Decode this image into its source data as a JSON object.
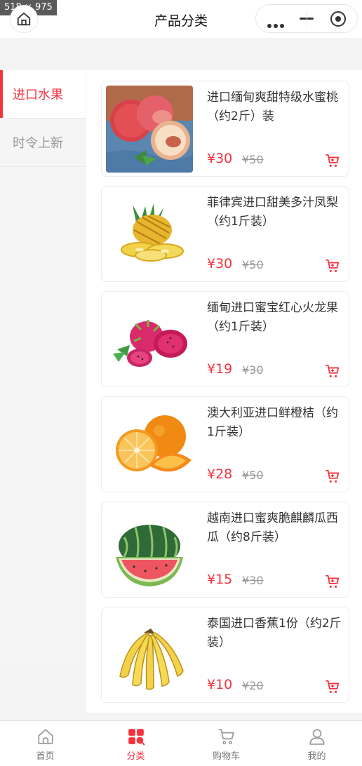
{
  "overlay": {
    "dimensions": "518 × 975"
  },
  "navbar": {
    "title": "产品分类"
  },
  "sidebar": {
    "items": [
      {
        "label": "进口水果"
      },
      {
        "label": "时令上新"
      }
    ]
  },
  "products": [
    {
      "name": "进口缅甸爽甜特级水蜜桃（约2斤）装",
      "price": "¥30",
      "old_price": "¥50",
      "image": "peach-image"
    },
    {
      "name": "菲律宾进口甜美多汁凤梨（约1斤装）",
      "price": "¥30",
      "old_price": "¥50",
      "image": "pineapple-image"
    },
    {
      "name": "缅甸进口蜜宝红心火龙果（约1斤装）",
      "price": "¥19",
      "old_price": "¥30",
      "image": "dragon-fruit-image"
    },
    {
      "name": "澳大利亚进口鲜橙桔（约1斤装）",
      "price": "¥28",
      "old_price": "¥50",
      "image": "orange-image"
    },
    {
      "name": "越南进口蜜爽脆麒麟瓜西瓜（约8斤装）",
      "price": "¥15",
      "old_price": "¥30",
      "image": "watermelon-image"
    },
    {
      "name": "泰国进口香蕉1份（约2斤装）",
      "price": "¥10",
      "old_price": "¥20",
      "image": "banana-image"
    }
  ],
  "tabbar": {
    "items": [
      {
        "label": "首页",
        "icon": "home-icon"
      },
      {
        "label": "分类",
        "icon": "category-icon"
      },
      {
        "label": "购物车",
        "icon": "cart-icon"
      },
      {
        "label": "我的",
        "icon": "user-icon"
      }
    ]
  },
  "colors": {
    "accent": "#f5333f",
    "background": "#f4f4f4",
    "muted": "#999999"
  }
}
